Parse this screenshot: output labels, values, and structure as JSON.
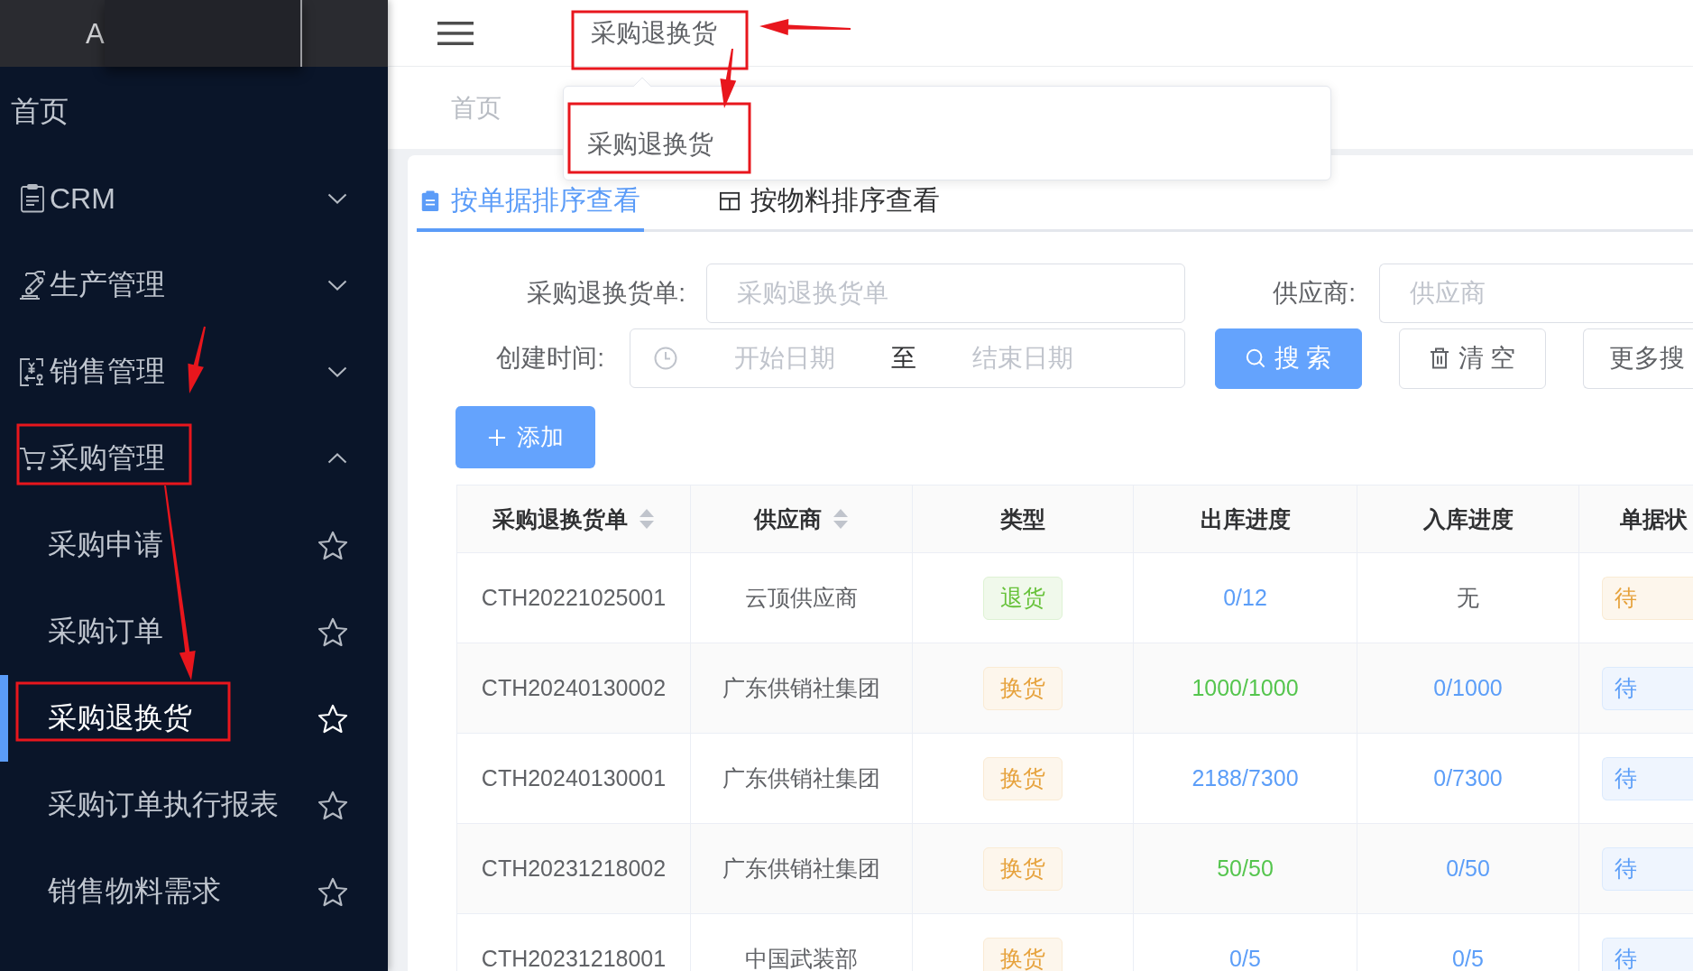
{
  "sidebar": {
    "logo_text": "A",
    "menu": [
      {
        "label": "首页",
        "kind": "link"
      },
      {
        "label": "CRM",
        "kind": "group",
        "expanded": false
      },
      {
        "label": "生产管理",
        "kind": "group",
        "expanded": false
      },
      {
        "label": "销售管理",
        "kind": "group",
        "expanded": false
      },
      {
        "label": "采购管理",
        "kind": "group",
        "expanded": true,
        "children": [
          {
            "label": "采购申请",
            "selected": false
          },
          {
            "label": "采购订单",
            "selected": false
          },
          {
            "label": "采购退换货",
            "selected": true
          },
          {
            "label": "采购订单执行报表",
            "selected": false
          },
          {
            "label": "销售物料需求",
            "selected": false
          }
        ]
      }
    ]
  },
  "top_bar": {
    "breadcrumb": "采购退换货"
  },
  "tags_view": {
    "tags": [
      {
        "label": "首页",
        "selected": false
      }
    ]
  },
  "search_dropdown": {
    "items": [
      {
        "label": "采购退换货",
        "selected": false
      }
    ]
  },
  "tabs": [
    {
      "label": "按单据排序查看",
      "selected": true
    },
    {
      "label": "按物料排序查看",
      "selected": false
    }
  ],
  "filters": {
    "order_field": {
      "label": "采购退换货单:",
      "placeholder": "采购退换货单"
    },
    "supplier_field": {
      "label": "供应商:",
      "placeholder": "供应商"
    },
    "created_range": {
      "label": "创建时间:",
      "start_placeholder": "开始日期",
      "separator": "至",
      "end_placeholder": "结束日期"
    },
    "buttons": [
      {
        "label": "搜 索",
        "kind": "search"
      },
      {
        "label": "清 空",
        "kind": "clear"
      },
      {
        "label": "更多搜",
        "kind": "more"
      }
    ]
  },
  "add_button": {
    "label": "添加"
  },
  "table": {
    "columns": [
      {
        "label": "采购退换货单",
        "sortable": true
      },
      {
        "label": "供应商",
        "sortable": true
      },
      {
        "label": "类型",
        "sortable": false
      },
      {
        "label": "出库进度",
        "sortable": false
      },
      {
        "label": "入库进度",
        "sortable": false
      },
      {
        "label": "单据状"
      }
    ],
    "rows": [
      {
        "number": "CTH20221025001",
        "supplier": "云顶供应商",
        "type": {
          "text": "退货",
          "color": "#67c23a"
        },
        "outbound": {
          "text": "0/12",
          "color": "#5c9ef8"
        },
        "inbound": {
          "text": "无",
          "color": "#606266"
        },
        "doc_status": {
          "text": "待",
          "color": "#e6a23c"
        }
      },
      {
        "number": "CTH20240130002",
        "supplier": "广东供销社集团",
        "type": {
          "text": "换货",
          "color": "#e6a23c"
        },
        "outbound": {
          "text": "1000/1000",
          "color": "#55c54e"
        },
        "inbound": {
          "text": "0/1000",
          "color": "#5c9ef8"
        },
        "doc_status": {
          "text": "待",
          "color": "#5c9ef8"
        }
      },
      {
        "number": "CTH20240130001",
        "supplier": "广东供销社集团",
        "type": {
          "text": "换货",
          "color": "#e6a23c"
        },
        "outbound": {
          "text": "2188/7300",
          "color": "#5c9ef8"
        },
        "inbound": {
          "text": "0/7300",
          "color": "#5c9ef8"
        },
        "doc_status": {
          "text": "待",
          "color": "#5c9ef8"
        }
      },
      {
        "number": "CTH20231218002",
        "supplier": "广东供销社集团",
        "type": {
          "text": "换货",
          "color": "#e6a23c"
        },
        "outbound": {
          "text": "50/50",
          "color": "#55c54e"
        },
        "inbound": {
          "text": "0/50",
          "color": "#5c9ef8"
        },
        "doc_status": {
          "text": "待",
          "color": "#5c9ef8"
        }
      },
      {
        "number": "CTH20231218001",
        "supplier": "中国武装部",
        "type": {
          "text": "换货",
          "color": "#e6a23c"
        },
        "outbound": {
          "text": "0/5",
          "color": "#5c9ef8"
        },
        "inbound": {
          "text": "0/5",
          "color": "#5c9ef8"
        },
        "doc_status": {
          "text": "待",
          "color": "#5c9ef8"
        }
      }
    ]
  }
}
